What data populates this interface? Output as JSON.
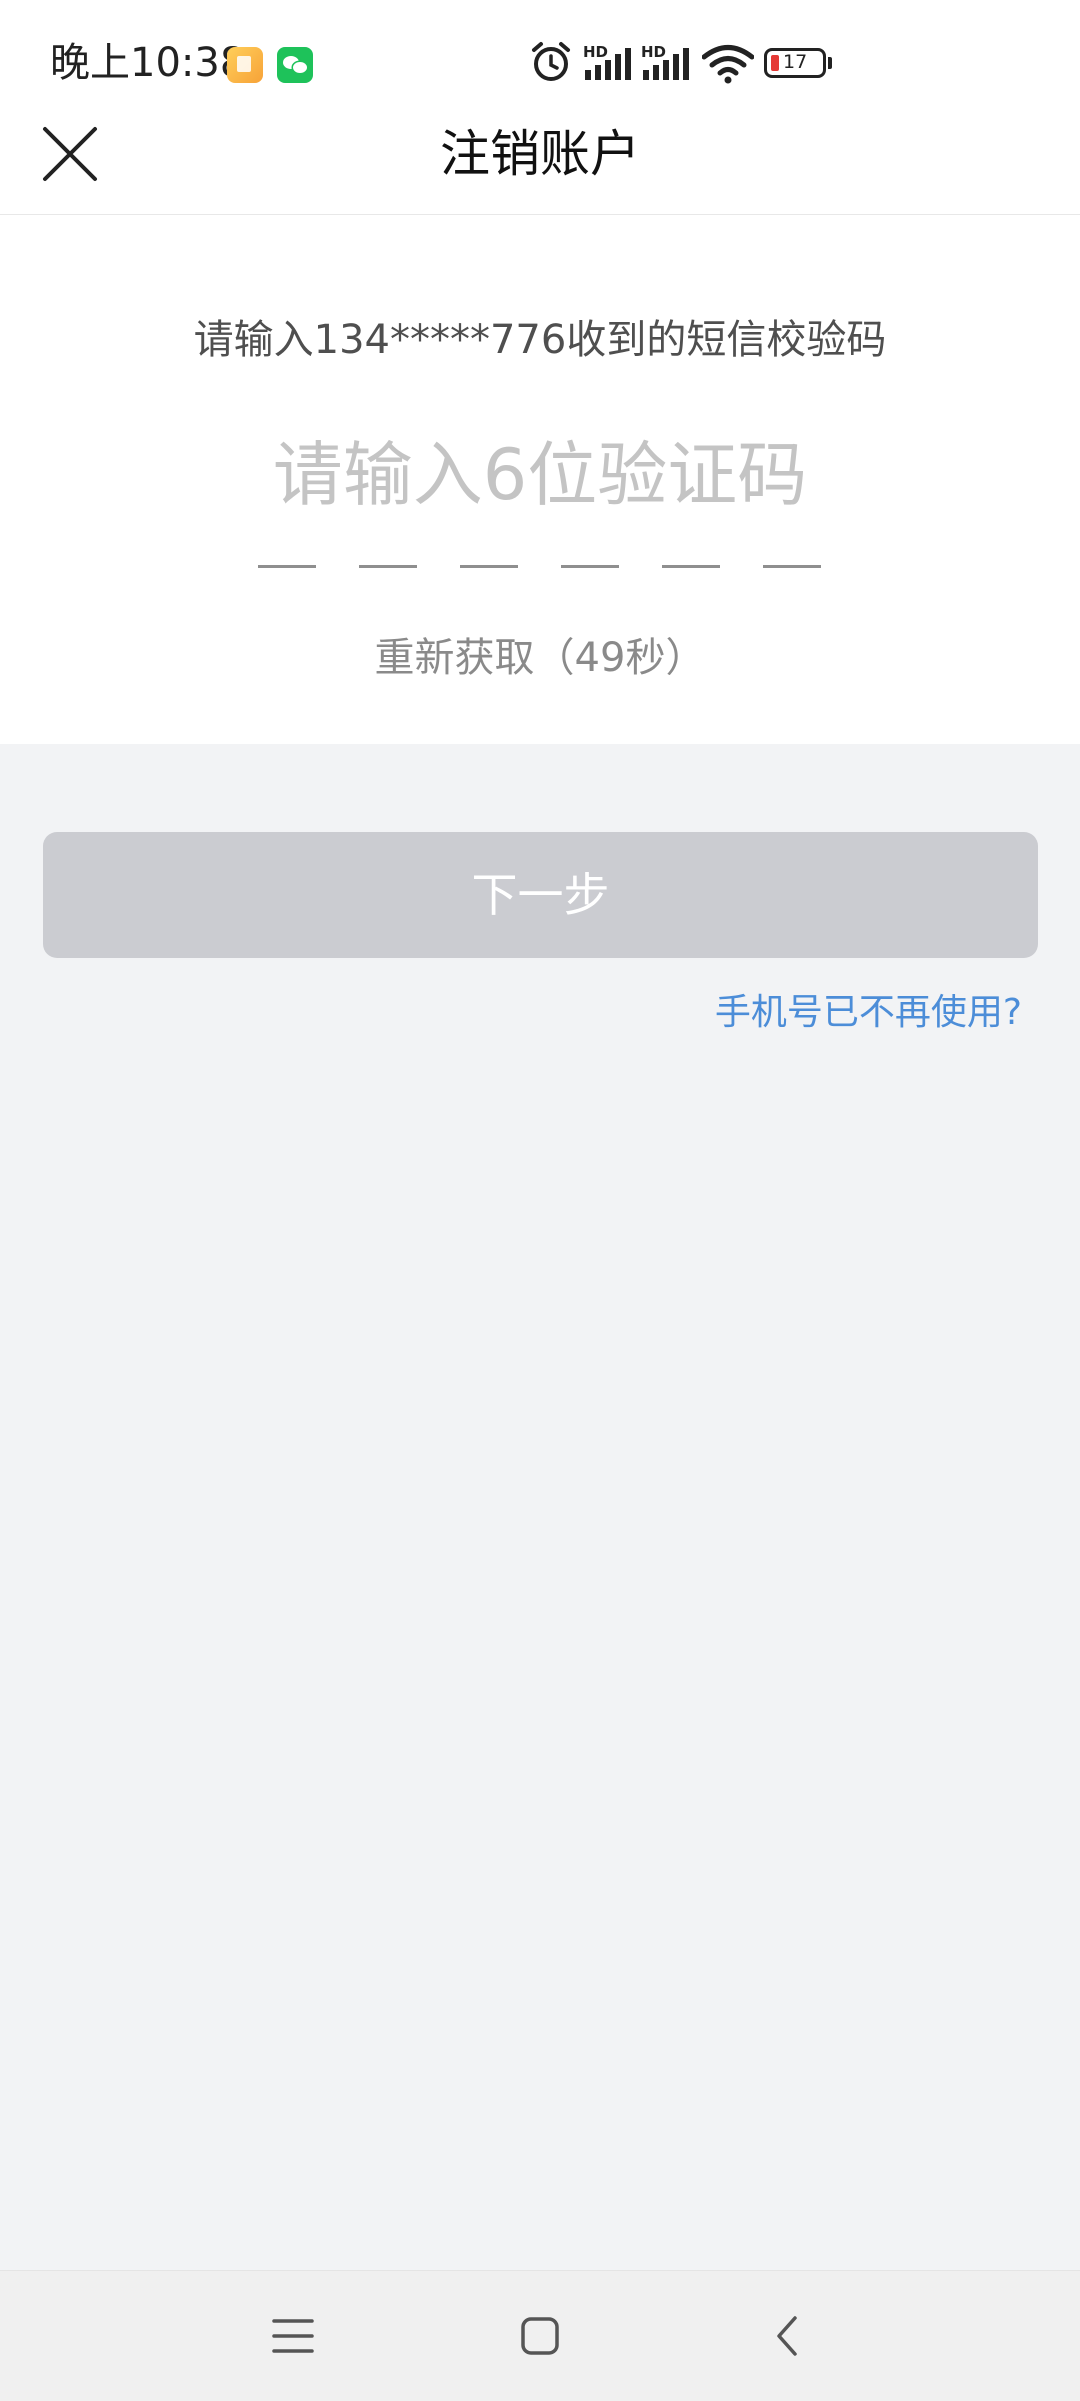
{
  "status_bar": {
    "time": "晚上10:38",
    "battery_level": "17",
    "signal_1_label": "HD",
    "signal_2_label": "HD",
    "icons": [
      "gallery-notification-icon",
      "wechat-notification-icon",
      "alarm-icon",
      "signal-icon",
      "signal-icon",
      "wifi-icon",
      "battery-icon"
    ],
    "battery_color": "#e53935"
  },
  "header": {
    "title": "注销账户",
    "close_icon": "close-icon"
  },
  "verification": {
    "instruction": "请输入134*****776收到的短信校验码",
    "code_placeholder": "请输入6位验证码",
    "code_value": "",
    "code_length": 6,
    "resend_label": "重新获取（49秒）"
  },
  "actions": {
    "next_label": "下一步",
    "phone_unused_link": "手机号已不再使用?"
  },
  "colors": {
    "link": "#4c8dd8",
    "button_disabled": "#cbccd1",
    "background": "#f2f3f5"
  },
  "nav_bar": {
    "icons": [
      "menu-icon",
      "home-icon",
      "back-icon"
    ]
  }
}
